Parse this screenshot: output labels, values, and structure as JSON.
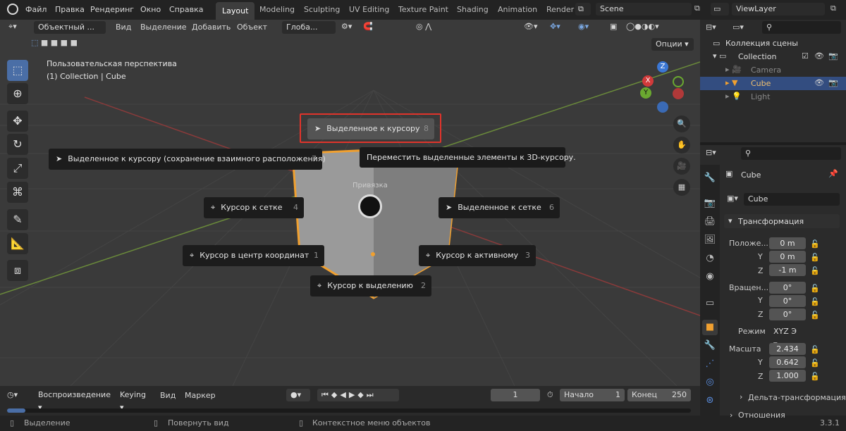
{
  "topbar": {
    "menus": [
      "Файл",
      "Правка",
      "Рендеринг",
      "Окно",
      "Справка"
    ],
    "workspaces": [
      "Layout",
      "Modeling",
      "Sculpting",
      "UV Editing",
      "Texture Paint",
      "Shading",
      "Animation",
      "Render"
    ],
    "scene": "Scene",
    "view_layer": "ViewLayer"
  },
  "vp_header": {
    "mode": "Объектный ...",
    "menus": [
      "Вид",
      "Выделение",
      "Добавить",
      "Объект"
    ],
    "orient": "Глоба...",
    "options": "Опции"
  },
  "viewport": {
    "title": "Пользовательская перспектива",
    "subtitle": "(1) Collection | Cube",
    "origin_label": "Привязка"
  },
  "gizmo": {
    "z": "Z",
    "x": "X",
    "y": "Y"
  },
  "pie": [
    {
      "label": "Выделенное к курсору",
      "num": "8"
    },
    {
      "label": "Выделенное к курсору (сохранение взаимного расположения)",
      "num": "7"
    },
    {
      "label": "Курсор к сетке",
      "num": "4"
    },
    {
      "label": "Выделенное к сетке",
      "num": "6"
    },
    {
      "label": "Курсор в центр координат",
      "num": "1"
    },
    {
      "label": "Курсор к активному",
      "num": "3"
    },
    {
      "label": "Курсор к выделению",
      "num": "2"
    }
  ],
  "tooltip": "Переместить выделенные элементы к 3D-курсору.",
  "highlight_color": "#e0342b",
  "timeline": {
    "playback": "Воспроизведение",
    "keying": "Keying",
    "view": "Вид",
    "marker": "Маркер",
    "frame": "1",
    "start_label": "Начало",
    "start": "1",
    "end_label": "Конец",
    "end": "250"
  },
  "status": {
    "a": "Выделение",
    "b": "Повернуть вид",
    "c": "Контекстное меню объектов",
    "version": "3.3.1"
  },
  "outliner": {
    "scene_collection": "Коллекция сцены",
    "items": [
      "Collection",
      "Camera",
      "Cube",
      "Light"
    ]
  },
  "props": {
    "object": "Cube",
    "object_field": "Cube",
    "section": "Трансформация",
    "loc_label": "Положе...",
    "rot_label": "Вращен...",
    "mode_label": "Режим",
    "mode_value": "XYZ Э",
    "scale_label": "Масшта",
    "y": "Y",
    "z": "Z",
    "loc": [
      "0 m",
      "0 m",
      "-1 m"
    ],
    "rot": [
      "0°",
      "0°",
      "0°"
    ],
    "scale": [
      "2.434",
      "0.642",
      "1.000"
    ],
    "delta": "Дельта-трансформация",
    "relations": "Отношения"
  }
}
